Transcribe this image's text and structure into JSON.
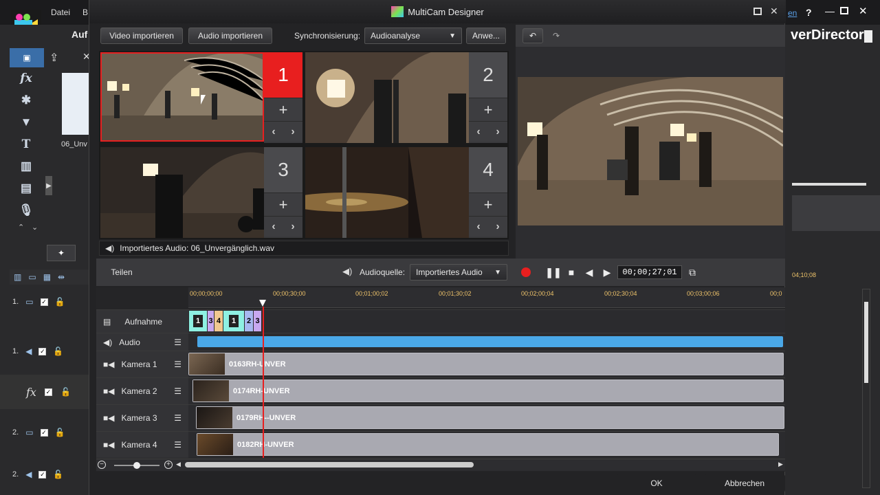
{
  "app": {
    "menu": [
      "Datei",
      "B"
    ],
    "tab_partial": "Auf",
    "brand_partial": "verDirector",
    "help_link_partial": "en",
    "media_item": "06_Unv",
    "tracks_left": [
      {
        "label": "1."
      },
      {
        "label": "1."
      },
      {
        "label": "fx"
      },
      {
        "label": "2."
      },
      {
        "label": "2."
      }
    ],
    "right_timecode": "04;10;08"
  },
  "dialog": {
    "title": "MultiCam Designer",
    "video_import": "Video importieren",
    "audio_import": "Audio importieren",
    "sync_label": "Synchronisierung:",
    "sync_value": "Audioanalyse",
    "apply": "Anwe...",
    "cameras": [
      {
        "number": "1",
        "selected": true
      },
      {
        "number": "2",
        "selected": false
      },
      {
        "number": "3",
        "selected": false
      },
      {
        "number": "4",
        "selected": false
      }
    ],
    "imported_audio": "Importiertes Audio: 06_Unvergänglich.wav",
    "split": "Teilen",
    "audio_source_label": "Audioquelle:",
    "audio_source_value": "Importiertes Audio",
    "timecode": "00;00;27;01",
    "ok": "OK",
    "cancel": "Abbrechen"
  },
  "timeline": {
    "ruler": [
      "00;00;00;00",
      "00;00;30;00",
      "00;01;00;02",
      "00;01;30;02",
      "00;02;00;04",
      "00;02;30;04",
      "00;03;00;06",
      "00;0"
    ],
    "tracks": [
      {
        "label": "Aufnahme"
      },
      {
        "label": "Audio"
      },
      {
        "label": "Kamera 1",
        "clip": "0163RH-UNVER"
      },
      {
        "label": "Kamera 2",
        "clip": "0174RH-UNVER"
      },
      {
        "label": "Kamera 3",
        "clip": "0179RH--UNVER"
      },
      {
        "label": "Kamera 4",
        "clip": "0182RH-UNVER"
      }
    ],
    "recording_segments": [
      "1",
      "3",
      "4",
      "1",
      "2",
      "3"
    ]
  },
  "colors": {
    "accent_red": "#e81f1f",
    "audio_wave": "#4aa8e8",
    "ruler_text": "#eec36a"
  }
}
